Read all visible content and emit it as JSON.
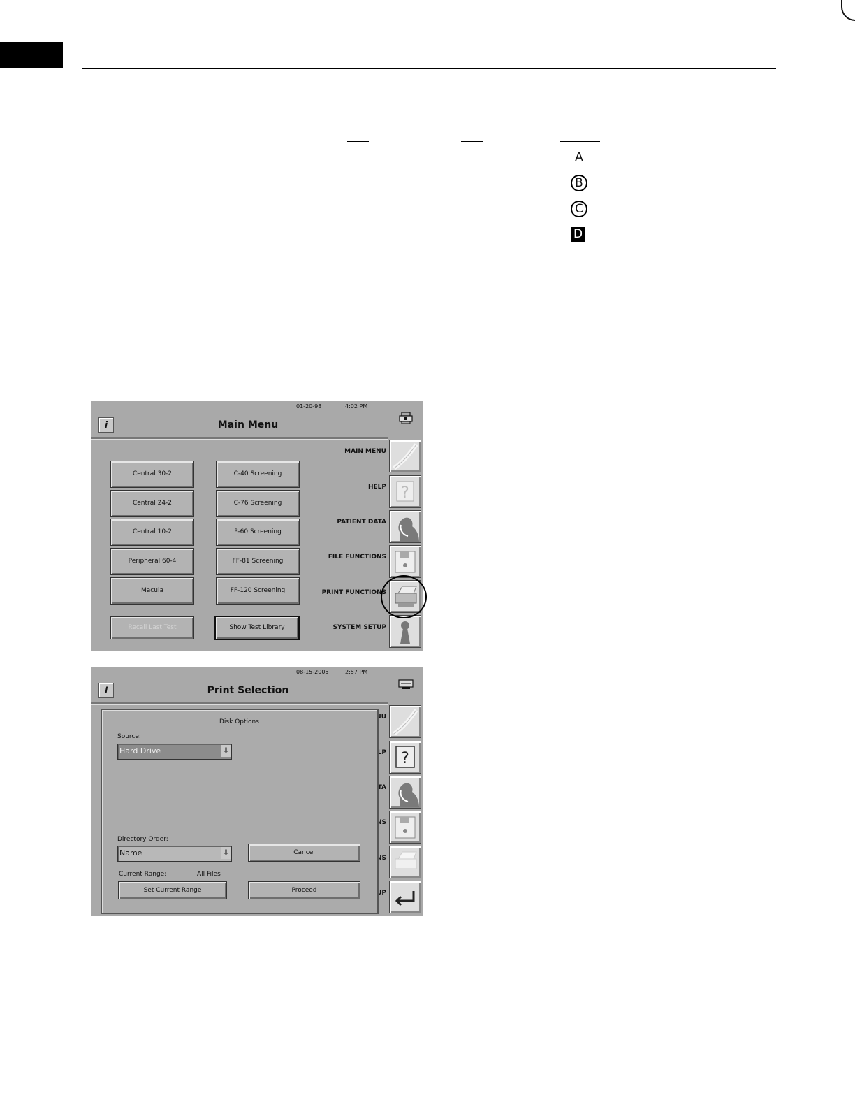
{
  "page": {
    "symbols": [
      "A",
      "B",
      "C",
      "D"
    ]
  },
  "main_menu": {
    "date": "01-20-98",
    "time": "4:02 PM",
    "title": "Main Menu",
    "info_label": "i",
    "icon": "printer-lock-icon",
    "tests_left": [
      "Central 30-2",
      "Central 24-2",
      "Central 10-2",
      "Peripheral 60-4",
      "Macula"
    ],
    "tests_right": [
      "C-40 Screening",
      "C-76 Screening",
      "P-60 Screening",
      "FF-81 Screening",
      "FF-120 Screening"
    ],
    "recall_label": "Recall Last Test",
    "library_label": "Show Test Library",
    "sidebar": [
      {
        "label": "MAIN MENU",
        "icon": "main-menu-icon"
      },
      {
        "label": "HELP",
        "icon": "help-icon"
      },
      {
        "label": "PATIENT DATA",
        "icon": "patient-icon"
      },
      {
        "label": "FILE FUNCTIONS",
        "icon": "floppy-disk-icon"
      },
      {
        "label": "PRINT FUNCTIONS",
        "icon": "printer-icon"
      },
      {
        "label": "SYSTEM SETUP",
        "icon": "keyhole-icon"
      }
    ]
  },
  "print_selection": {
    "date": "08-15-2005",
    "time": "2:57 PM",
    "title": "Print Selection",
    "info_label": "i",
    "icon": "printer-icon",
    "dialog_title": "Disk Options",
    "source_label": "Source:",
    "source_value": "Hard Drive",
    "dir_order_label": "Directory Order:",
    "dir_order_value": "Name",
    "cancel_label": "Cancel",
    "range_label": "Current Range:",
    "range_value": "All Files",
    "set_range_label": "Set Current Range",
    "proceed_label": "Proceed",
    "sidebar_fragments": [
      "NU",
      "ELP",
      "TA",
      "NS",
      "NS",
      "UP"
    ]
  }
}
